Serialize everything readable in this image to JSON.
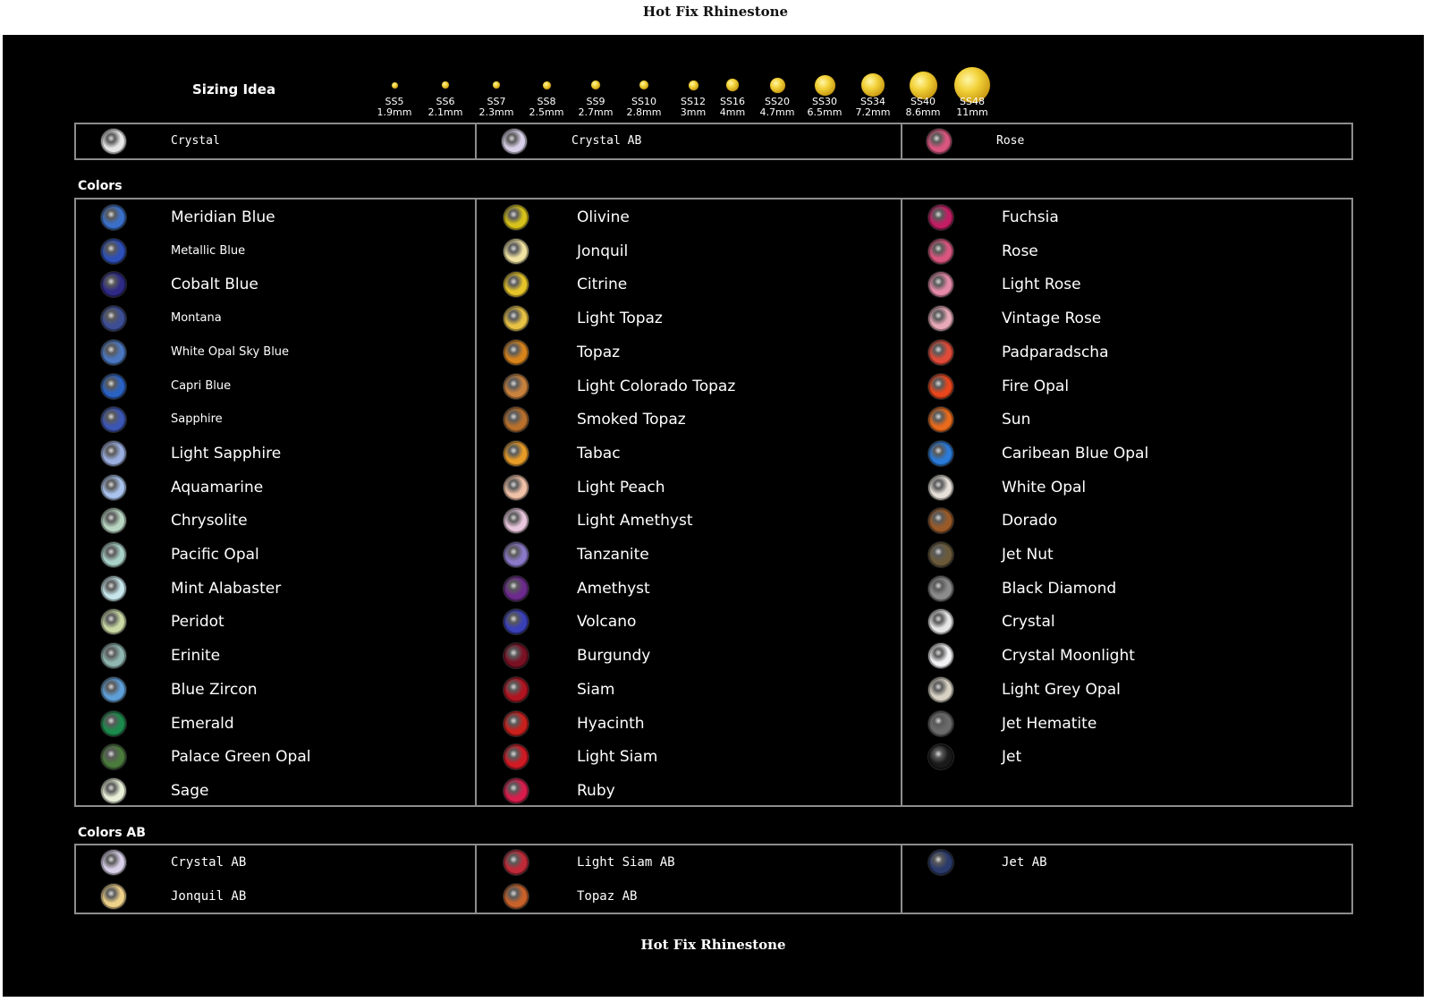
{
  "title": "Hot Fix Rhinestone",
  "footer_title": "Hot Fix Rhinestone",
  "sizing": {
    "label": "Sizing Idea",
    "sizes": [
      {
        "code": "SS5",
        "mm": "1.9mm",
        "dia": 1.9
      },
      {
        "code": "SS6",
        "mm": "2.1mm",
        "dia": 2.1
      },
      {
        "code": "SS7",
        "mm": "2.3mm",
        "dia": 2.3
      },
      {
        "code": "SS8",
        "mm": "2.5mm",
        "dia": 2.5
      },
      {
        "code": "SS9",
        "mm": "2.7mm",
        "dia": 2.7
      },
      {
        "code": "SS10",
        "mm": "2.8mm",
        "dia": 2.8
      },
      {
        "code": "SS12",
        "mm": "3mm",
        "dia": 3.0
      },
      {
        "code": "SS16",
        "mm": "4mm",
        "dia": 4.0
      },
      {
        "code": "SS20",
        "mm": "4.7mm",
        "dia": 4.7
      },
      {
        "code": "SS30",
        "mm": "6.5mm",
        "dia": 6.5
      },
      {
        "code": "SS34",
        "mm": "7.2mm",
        "dia": 7.2
      },
      {
        "code": "SS40",
        "mm": "8.6mm",
        "dia": 8.6
      },
      {
        "code": "SS48",
        "mm": "11mm",
        "dia": 11.0
      }
    ]
  },
  "clear_row": [
    {
      "name": "Crystal",
      "color": "#e6e6e6"
    },
    {
      "name": "Crystal AB",
      "color": "#d8d0e8"
    },
    {
      "name": "Rose",
      "color": "#d9567e"
    }
  ],
  "colors_label": "Colors",
  "colors": {
    "col1": [
      {
        "name": "Meridian Blue",
        "color": "#3a6fc9",
        "small": false
      },
      {
        "name": "Metallic Blue",
        "color": "#2d4fb8",
        "small": true
      },
      {
        "name": "Cobalt Blue",
        "color": "#2e2a86",
        "small": false
      },
      {
        "name": "Montana",
        "color": "#3d4e95",
        "small": true
      },
      {
        "name": "White Opal Sky Blue",
        "color": "#4a77c0",
        "small": true
      },
      {
        "name": "Capri Blue",
        "color": "#2a62c4",
        "small": true
      },
      {
        "name": "Sapphire",
        "color": "#3c56b4",
        "small": true
      },
      {
        "name": "Light Sapphire",
        "color": "#9aaee0",
        "small": false
      },
      {
        "name": "Aquamarine",
        "color": "#a9c3ec",
        "small": false
      },
      {
        "name": "Chrysolite",
        "color": "#b8d6c2",
        "small": false
      },
      {
        "name": "Pacific Opal",
        "color": "#a8d2c8",
        "small": false
      },
      {
        "name": "Mint Alabaster",
        "color": "#c6e6ec",
        "small": false
      },
      {
        "name": "Peridot",
        "color": "#c9d8a4",
        "small": false
      },
      {
        "name": "Erinite",
        "color": "#8fb6b0",
        "small": false
      },
      {
        "name": "Blue Zircon",
        "color": "#5e9fd8",
        "small": false
      },
      {
        "name": "Emerald",
        "color": "#1c8a4c",
        "small": false
      },
      {
        "name": "Palace Green Opal",
        "color": "#4a7a3c",
        "small": false
      },
      {
        "name": "Sage",
        "color": "#e8f0d8",
        "small": false
      }
    ],
    "col2": [
      {
        "name": "Olivine",
        "color": "#d6c21a"
      },
      {
        "name": "Jonquil",
        "color": "#efe2a2"
      },
      {
        "name": "Citrine",
        "color": "#e6c52a"
      },
      {
        "name": "Light Topaz",
        "color": "#e8c244"
      },
      {
        "name": "Topaz",
        "color": "#d7831c"
      },
      {
        "name": "Light Colorado Topaz",
        "color": "#c9823e"
      },
      {
        "name": "Smoked Topaz",
        "color": "#b8702c"
      },
      {
        "name": "Tabac",
        "color": "#e89c28"
      },
      {
        "name": "Light Peach",
        "color": "#f1c2a8"
      },
      {
        "name": "Light Amethyst",
        "color": "#e8c6dc"
      },
      {
        "name": "Tanzanite",
        "color": "#8a78c8"
      },
      {
        "name": "Amethyst",
        "color": "#6c2a8c"
      },
      {
        "name": "Volcano",
        "color": "#3a40b8"
      },
      {
        "name": "Burgundy",
        "color": "#7a1024"
      },
      {
        "name": "Siam",
        "color": "#b01420"
      },
      {
        "name": "Hyacinth",
        "color": "#c8201c"
      },
      {
        "name": "Light Siam",
        "color": "#d01a24"
      },
      {
        "name": "Ruby",
        "color": "#d81c4c"
      }
    ],
    "col3": [
      {
        "name": "Fuchsia",
        "color": "#c21e64"
      },
      {
        "name": "Rose",
        "color": "#d9567e"
      },
      {
        "name": "Light Rose",
        "color": "#e48aa8"
      },
      {
        "name": "Vintage Rose",
        "color": "#e8aab8"
      },
      {
        "name": "Padparadscha",
        "color": "#e04a38"
      },
      {
        "name": "Fire Opal",
        "color": "#e8461c"
      },
      {
        "name": "Sun",
        "color": "#e86a1c"
      },
      {
        "name": "Caribean Blue Opal",
        "color": "#2a7ad8"
      },
      {
        "name": "White Opal",
        "color": "#e6e0d8"
      },
      {
        "name": "Dorado",
        "color": "#9a5a28"
      },
      {
        "name": "Jet Nut",
        "color": "#6a5a3a"
      },
      {
        "name": "Black Diamond",
        "color": "#8c8c8c"
      },
      {
        "name": "Crystal",
        "color": "#e6e6e6"
      },
      {
        "name": "Crystal Moonlight",
        "color": "#f2f2f4"
      },
      {
        "name": "Light Grey Opal",
        "color": "#d8d2c4"
      },
      {
        "name": "Jet Hematite",
        "color": "#6a6a6a"
      },
      {
        "name": "Jet",
        "color": "#1a1a1a"
      }
    ]
  },
  "colors_ab_label": "Colors AB",
  "colors_ab": {
    "col1": [
      {
        "name": "Crystal AB",
        "color": "#d8d0e8"
      },
      {
        "name": "Jonquil AB",
        "color": "#efd28a"
      }
    ],
    "col2": [
      {
        "name": "Light Siam AB",
        "color": "#c02a38"
      },
      {
        "name": "Topaz AB",
        "color": "#c8622a"
      }
    ],
    "col3": [
      {
        "name": "Jet AB",
        "color": "#2a3a6a"
      }
    ]
  }
}
